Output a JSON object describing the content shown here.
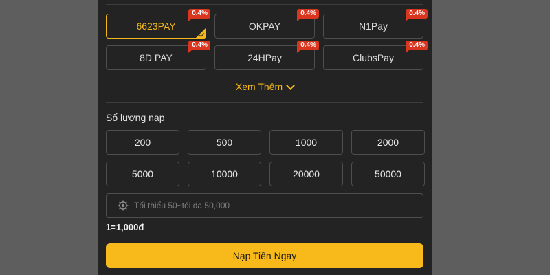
{
  "payment_methods": [
    {
      "name": "6623PAY",
      "rate": "0.4%"
    },
    {
      "name": "OKPAY",
      "rate": "0.4%"
    },
    {
      "name": "N1Pay",
      "rate": "0.4%"
    },
    {
      "name": "8D PAY",
      "rate": "0.4%"
    },
    {
      "name": "24HPay",
      "rate": "0.4%"
    },
    {
      "name": "ClubsPay",
      "rate": "0.4%"
    }
  ],
  "see_more_label": "Xem Thêm",
  "amount_section": {
    "label": "Số lượng nạp",
    "options": [
      "200",
      "500",
      "1000",
      "2000",
      "5000",
      "10000",
      "20000",
      "50000"
    ]
  },
  "amount_input": {
    "value": "",
    "placeholder": "Tối thiểu 50~tối đa 50,000"
  },
  "rate_text": "1=1,000đ",
  "deposit_button_label": "Nạp Tiền Ngay",
  "colors": {
    "accent": "#f5b71a",
    "badge": "#d9351f",
    "panel": "#232323",
    "backdrop": "#5e5e5e"
  }
}
